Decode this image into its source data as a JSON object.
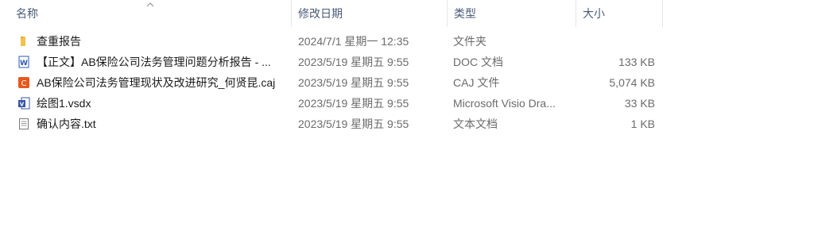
{
  "columns": {
    "name": "名称",
    "date": "修改日期",
    "type": "类型",
    "size": "大小"
  },
  "files": [
    {
      "name": "查重报告",
      "date": "2024/7/1 星期一 12:35",
      "type": "文件夹",
      "size": "",
      "icon": "folder-icon"
    },
    {
      "name": "【正文】AB保险公司法务管理问题分析报告 - ...",
      "date": "2023/5/19 星期五 9:55",
      "type": "DOC 文档",
      "size": "133 KB",
      "icon": "word-doc-icon"
    },
    {
      "name": "AB保险公司法务管理现状及改进研究_何贤昆.caj",
      "date": "2023/5/19 星期五 9:55",
      "type": "CAJ 文件",
      "size": "5,074 KB",
      "icon": "caj-file-icon"
    },
    {
      "name": "绘图1.vsdx",
      "date": "2023/5/19 星期五 9:55",
      "type": "Microsoft Visio Dra...",
      "size": "33 KB",
      "icon": "visio-icon"
    },
    {
      "name": "确认内容.txt",
      "date": "2023/5/19 星期五 9:55",
      "type": "文本文档",
      "size": "1 KB",
      "icon": "text-file-icon"
    }
  ],
  "colors": {
    "header_text": "#4a5a78",
    "folder": "#f2c14b",
    "word": "#2b5bb5",
    "caj": "#e8581c",
    "visio": "#3955a3"
  }
}
